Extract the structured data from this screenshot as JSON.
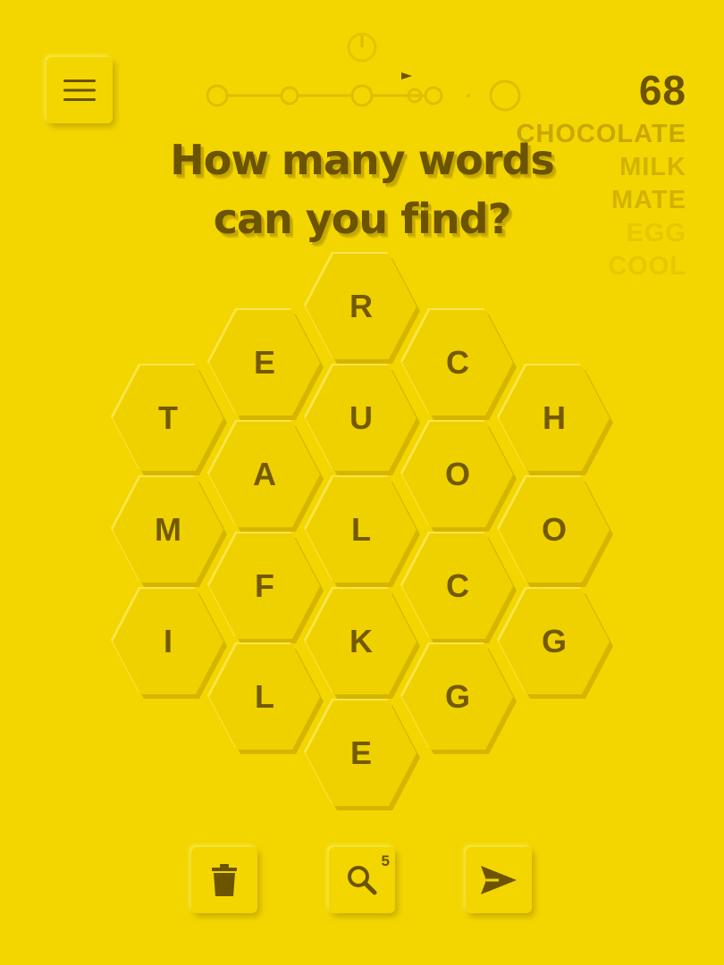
{
  "header": {
    "menu_icon": "hamburger-menu-icon",
    "score": "68",
    "found_words": [
      "CHOCOLATE",
      "MILK",
      "MATE",
      "EGG",
      "COOL"
    ]
  },
  "progress": {
    "icon": "timer-icon",
    "checkpoints": 4
  },
  "headline": {
    "line1": "How many words",
    "line2": "can you find?"
  },
  "board": {
    "tiles": [
      {
        "letter": "R"
      },
      {
        "letter": "E"
      },
      {
        "letter": "C"
      },
      {
        "letter": "T"
      },
      {
        "letter": "U"
      },
      {
        "letter": "H"
      },
      {
        "letter": "A"
      },
      {
        "letter": "O"
      },
      {
        "letter": "M"
      },
      {
        "letter": "L"
      },
      {
        "letter": "O"
      },
      {
        "letter": "F"
      },
      {
        "letter": "C"
      },
      {
        "letter": "I"
      },
      {
        "letter": "K"
      },
      {
        "letter": "G"
      },
      {
        "letter": "L"
      },
      {
        "letter": "G"
      },
      {
        "letter": "E"
      }
    ]
  },
  "toolbar": {
    "delete_icon": "trash-icon",
    "hint_icon": "search-icon",
    "hint_count": "5",
    "submit_icon": "send-arrow-icon"
  },
  "colors": {
    "background": "#f3d600",
    "text": "#6b5300"
  }
}
